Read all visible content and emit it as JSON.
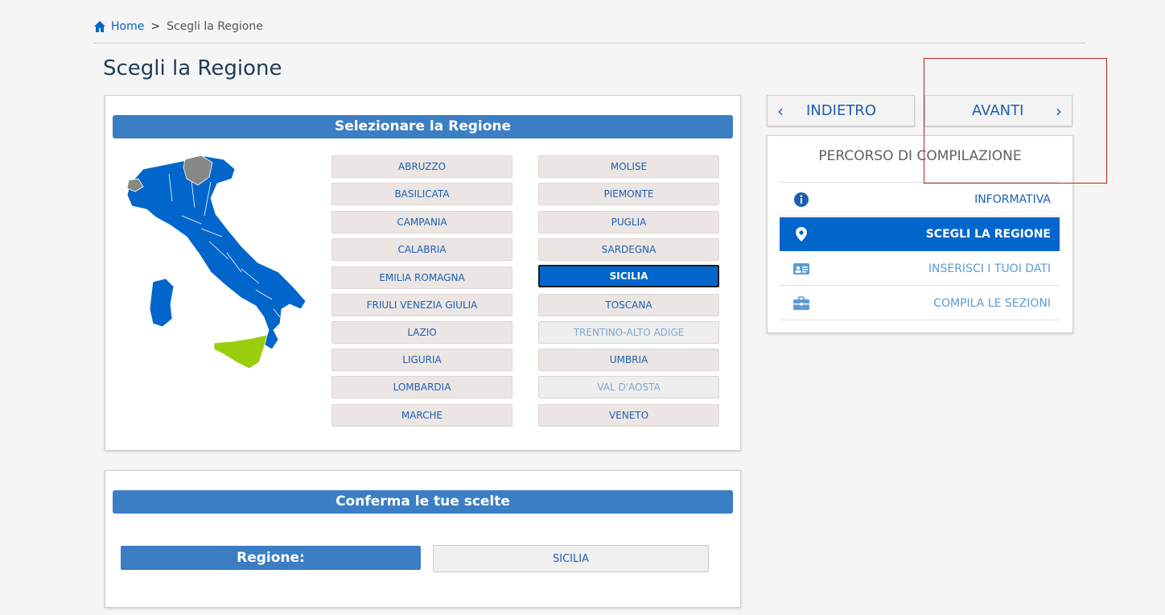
{
  "breadcrumb": {
    "home": "Home",
    "separator": ">",
    "current": "Scegli la Regione"
  },
  "page_title": "Scegli la Regione",
  "regions_panel": {
    "header": "Selezionare la Regione",
    "left_column": [
      "ABRUZZO",
      "BASILICATA",
      "CAMPANIA",
      "CALABRIA",
      "EMILIA ROMAGNA",
      "FRIULI VENEZIA GIULIA",
      "LAZIO",
      "LIGURIA",
      "LOMBARDIA",
      "MARCHE"
    ],
    "right_column": [
      "MOLISE",
      "PIEMONTE",
      "PUGLIA",
      "SARDEGNA",
      "SICILIA",
      "TOSCANA",
      "TRENTINO-ALTO ADIGE",
      "UMBRIA",
      "VAL D'AOSTA",
      "VENETO"
    ],
    "selected": "SICILIA",
    "disabled": [
      "TRENTINO-ALTO ADIGE",
      "VAL D'AOSTA"
    ],
    "map_colors": {
      "regions": "#0066cc",
      "selected": "#9acd0e",
      "disabled": "#888888"
    }
  },
  "nav": {
    "back": "INDIETRO",
    "next": "AVANTI"
  },
  "progress": {
    "title": "PERCORSO DI COMPILAZIONE",
    "steps": [
      {
        "label": "INFORMATIVA",
        "icon": "info-icon",
        "state": "done"
      },
      {
        "label": "SCEGLI LA REGIONE",
        "icon": "map-pin-icon",
        "state": "active"
      },
      {
        "label": "INSERISCI I TUOI DATI",
        "icon": "id-card-icon",
        "state": "pending"
      },
      {
        "label": "COMPILA LE SEZIONI",
        "icon": "briefcase-icon",
        "state": "pending"
      }
    ]
  },
  "confirm_panel": {
    "header": "Conferma le tue scelte",
    "region_label": "Regione:",
    "region_value": "SICILIA"
  },
  "colors": {
    "accent": "#0066cc",
    "header_blue": "#3b7ec4",
    "title": "#1f3b57"
  }
}
